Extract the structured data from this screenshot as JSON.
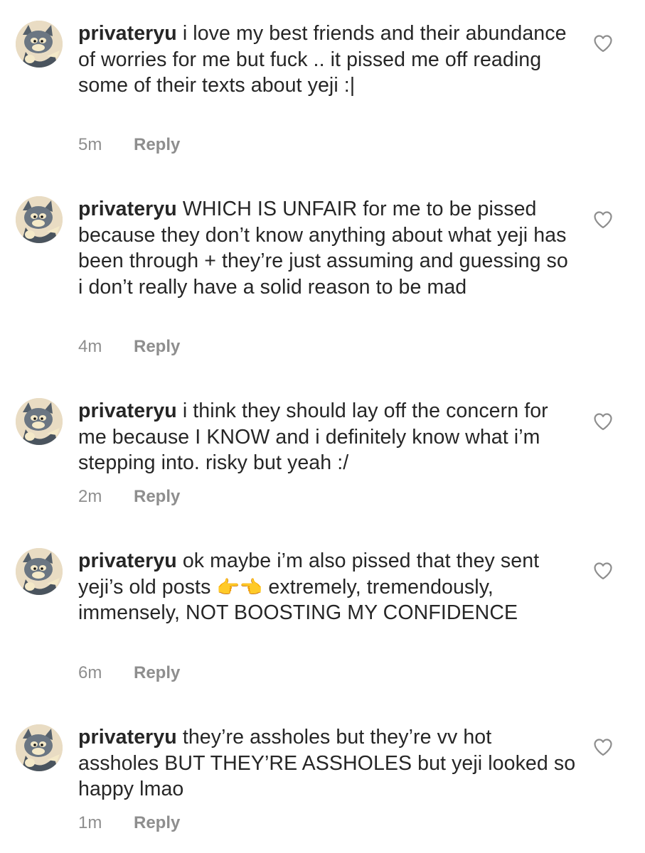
{
  "comments": [
    {
      "username": "privateryu",
      "text": "i love my best friends and their abundance of worries for me but fuck .. it pissed me off reading some of their texts about yeji :|",
      "time": "5m",
      "reply_label": "Reply",
      "avatar_icon": "tom-cat-avatar-icon",
      "like_icon": "heart-outline-icon"
    },
    {
      "username": "privateryu",
      "text": "WHICH IS UNFAIR for me to be pissed because they don’t know anything about what yeji has been through + they’re just assuming and guessing so i don’t really have a solid reason to be mad",
      "time": "4m",
      "reply_label": "Reply",
      "avatar_icon": "tom-cat-avatar-icon",
      "like_icon": "heart-outline-icon"
    },
    {
      "username": "privateryu",
      "text": "i think they should lay off the concern for me because I KNOW and i definitely know what i’m stepping into. risky but yeah :/",
      "time": "2m",
      "reply_label": "Reply",
      "avatar_icon": "tom-cat-avatar-icon",
      "like_icon": "heart-outline-icon"
    },
    {
      "username": "privateryu",
      "text_before_emoji": "ok maybe i’m also pissed that they sent yeji’s old posts ",
      "emoji": "👉👈",
      "text_after_emoji": " extremely, tremendously, immensely, NOT BOOSTING MY CONFIDENCE",
      "time": "6m",
      "reply_label": "Reply",
      "avatar_icon": "tom-cat-avatar-icon",
      "like_icon": "heart-outline-icon"
    },
    {
      "username": "privateryu",
      "text": "they’re assholes but they’re vv hot assholes BUT THEY’RE ASSHOLES but yeji looked so happy lmao",
      "time": "1m",
      "reply_label": "Reply",
      "avatar_icon": "tom-cat-avatar-icon",
      "like_icon": "heart-outline-icon"
    }
  ]
}
